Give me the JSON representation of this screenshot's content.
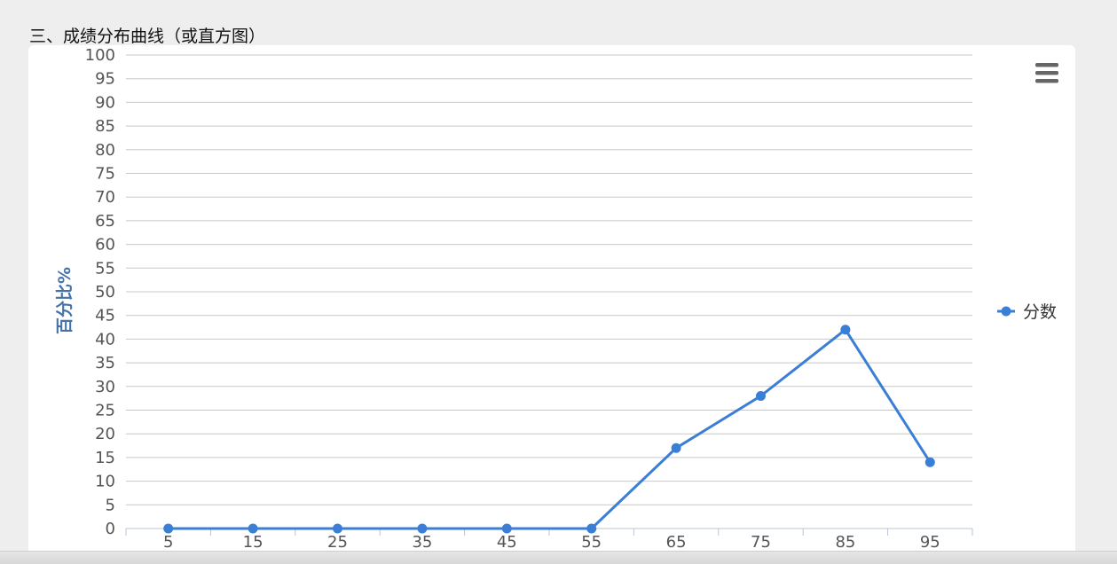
{
  "section": {
    "title": "三、成绩分布曲线（或直方图）"
  },
  "chart_data": {
    "type": "line",
    "x": [
      "5",
      "15",
      "25",
      "35",
      "45",
      "55",
      "65",
      "75",
      "85",
      "95"
    ],
    "series": [
      {
        "name": "分数",
        "values": [
          0,
          0,
          0,
          0,
          0,
          0,
          17,
          28,
          42,
          14
        ]
      }
    ],
    "ylabel": "百分比%",
    "ylim": [
      0,
      100
    ],
    "ytick_step": 5,
    "grid": true,
    "legend_placement": "right"
  },
  "toolbar": {
    "menu_icon": "hamburger-menu-icon"
  },
  "colors": {
    "series": "#3a7fd5",
    "axis_label": "#4572a7",
    "grid": "#c8c8c8",
    "text": "#555555"
  }
}
